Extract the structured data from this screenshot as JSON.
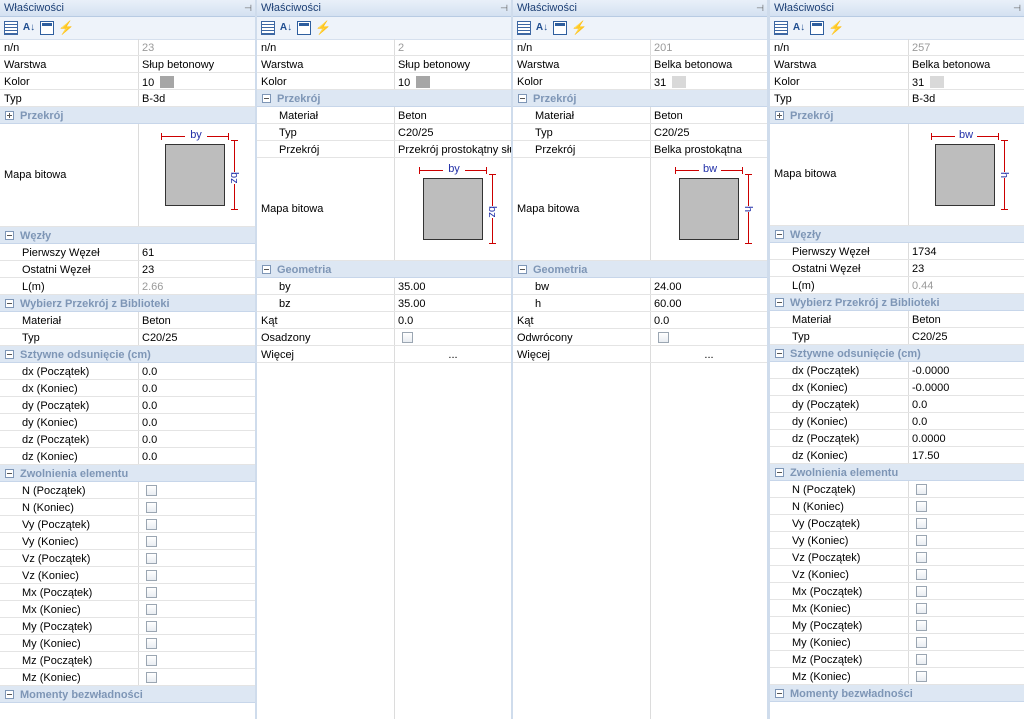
{
  "title": "Właściwości",
  "pin_glyph": "⊣",
  "panels": [
    {
      "rows": [
        {
          "t": "p",
          "n": "n/n",
          "v": "23",
          "ro": true
        },
        {
          "t": "p",
          "n": "Warstwa",
          "v": "Słup betonowy"
        },
        {
          "t": "p",
          "n": "Kolor",
          "v": "10",
          "sw": "#a6a6a6"
        },
        {
          "t": "p",
          "n": "Typ",
          "v": "B-3d"
        },
        {
          "t": "h",
          "n": "Przekrój",
          "c": true
        },
        {
          "t": "b",
          "n": "Mapa bitowa",
          "h1": "by",
          "h2": "bz"
        },
        {
          "t": "h",
          "n": "Węzły"
        },
        {
          "t": "p",
          "n": "Pierwszy Węzeł",
          "v": "61",
          "i": 1
        },
        {
          "t": "p",
          "n": "Ostatni Węzeł",
          "v": "23",
          "i": 1
        },
        {
          "t": "p",
          "n": "L(m)",
          "v": "2.66",
          "i": 1,
          "ro": true
        },
        {
          "t": "h",
          "n": "Wybierz Przekrój z Biblioteki"
        },
        {
          "t": "p",
          "n": "Materiał",
          "v": "Beton",
          "i": 1
        },
        {
          "t": "p",
          "n": "Typ",
          "v": "C20/25",
          "i": 1
        },
        {
          "t": "h",
          "n": "Sztywne odsunięcie (cm)"
        },
        {
          "t": "p",
          "n": "dx (Początek)",
          "v": "0.0",
          "i": 1
        },
        {
          "t": "p",
          "n": "dx (Koniec)",
          "v": "0.0",
          "i": 1
        },
        {
          "t": "p",
          "n": "dy (Początek)",
          "v": "0.0",
          "i": 1
        },
        {
          "t": "p",
          "n": "dy (Koniec)",
          "v": "0.0",
          "i": 1
        },
        {
          "t": "p",
          "n": "dz (Początek)",
          "v": "0.0",
          "i": 1
        },
        {
          "t": "p",
          "n": "dz (Koniec)",
          "v": "0.0",
          "i": 1
        },
        {
          "t": "h",
          "n": "Zwolnienia elementu"
        },
        {
          "t": "c",
          "n": "N (Początek)",
          "i": 1
        },
        {
          "t": "c",
          "n": "N (Koniec)",
          "i": 1
        },
        {
          "t": "c",
          "n": "Vy (Początek)",
          "i": 1
        },
        {
          "t": "c",
          "n": "Vy (Koniec)",
          "i": 1
        },
        {
          "t": "c",
          "n": "Vz (Początek)",
          "i": 1
        },
        {
          "t": "c",
          "n": "Vz (Koniec)",
          "i": 1
        },
        {
          "t": "c",
          "n": "Mx (Początek)",
          "i": 1
        },
        {
          "t": "c",
          "n": "Mx (Koniec)",
          "i": 1
        },
        {
          "t": "c",
          "n": "My (Początek)",
          "i": 1
        },
        {
          "t": "c",
          "n": "My (Koniec)",
          "i": 1
        },
        {
          "t": "c",
          "n": "Mz (Początek)",
          "i": 1
        },
        {
          "t": "c",
          "n": "Mz (Koniec)",
          "i": 1
        },
        {
          "t": "h",
          "n": "Momenty bezwładności"
        }
      ]
    },
    {
      "rows": [
        {
          "t": "p",
          "n": "n/n",
          "v": "2",
          "ro": true
        },
        {
          "t": "p",
          "n": "Warstwa",
          "v": "Słup betonowy"
        },
        {
          "t": "p",
          "n": "Kolor",
          "v": "10",
          "sw": "#a6a6a6"
        },
        {
          "t": "h",
          "n": "Przekrój"
        },
        {
          "t": "p",
          "n": "Materiał",
          "v": "Beton",
          "i": 1
        },
        {
          "t": "p",
          "n": "Typ",
          "v": "C20/25",
          "i": 1
        },
        {
          "t": "p",
          "n": "Przekrój",
          "v": "Przekrój prostokątny słu",
          "i": 1
        },
        {
          "t": "b",
          "n": "Mapa bitowa",
          "h1": "by",
          "h2": "bz"
        },
        {
          "t": "h",
          "n": "Geometria"
        },
        {
          "t": "p",
          "n": "by",
          "v": "35.00",
          "i": 1
        },
        {
          "t": "p",
          "n": "bz",
          "v": "35.00",
          "i": 1
        },
        {
          "t": "p",
          "n": "Kąt",
          "v": "0.0"
        },
        {
          "t": "c",
          "n": "Osadzony"
        },
        {
          "t": "e",
          "n": "Więcej",
          "v": "..."
        },
        {
          "t": "x"
        }
      ]
    },
    {
      "rows": [
        {
          "t": "p",
          "n": "n/n",
          "v": "201",
          "ro": true
        },
        {
          "t": "p",
          "n": "Warstwa",
          "v": "Belka betonowa"
        },
        {
          "t": "p",
          "n": "Kolor",
          "v": "31",
          "sw": "#d9d9d9"
        },
        {
          "t": "h",
          "n": "Przekrój"
        },
        {
          "t": "p",
          "n": "Materiał",
          "v": "Beton",
          "i": 1
        },
        {
          "t": "p",
          "n": "Typ",
          "v": "C20/25",
          "i": 1
        },
        {
          "t": "p",
          "n": "Przekrój",
          "v": "Belka prostokątna",
          "i": 1
        },
        {
          "t": "b",
          "n": "Mapa bitowa",
          "h1": "bw",
          "h2": "h"
        },
        {
          "t": "h",
          "n": "Geometria"
        },
        {
          "t": "p",
          "n": "bw",
          "v": "24.00",
          "i": 1
        },
        {
          "t": "p",
          "n": "h",
          "v": "60.00",
          "i": 1
        },
        {
          "t": "p",
          "n": "Kąt",
          "v": "0.0"
        },
        {
          "t": "c",
          "n": "Odwrócony"
        },
        {
          "t": "e",
          "n": "Więcej",
          "v": "..."
        },
        {
          "t": "x"
        }
      ]
    },
    {
      "rows": [
        {
          "t": "p",
          "n": "n/n",
          "v": "257",
          "ro": true
        },
        {
          "t": "p",
          "n": "Warstwa",
          "v": "Belka betonowa"
        },
        {
          "t": "p",
          "n": "Kolor",
          "v": "31",
          "sw": "#d9d9d9"
        },
        {
          "t": "p",
          "n": "Typ",
          "v": "B-3d"
        },
        {
          "t": "h",
          "n": "Przekrój",
          "c": true
        },
        {
          "t": "b",
          "n": "Mapa bitowa",
          "h1": "bw",
          "h2": "h"
        },
        {
          "t": "h",
          "n": "Węzły"
        },
        {
          "t": "p",
          "n": "Pierwszy Węzeł",
          "v": "1734",
          "i": 1
        },
        {
          "t": "p",
          "n": "Ostatni Węzeł",
          "v": "23",
          "i": 1
        },
        {
          "t": "p",
          "n": "L(m)",
          "v": "0.44",
          "i": 1,
          "ro": true
        },
        {
          "t": "h",
          "n": "Wybierz Przekrój z Biblioteki"
        },
        {
          "t": "p",
          "n": "Materiał",
          "v": "Beton",
          "i": 1
        },
        {
          "t": "p",
          "n": "Typ",
          "v": "C20/25",
          "i": 1
        },
        {
          "t": "h",
          "n": "Sztywne odsunięcie (cm)"
        },
        {
          "t": "p",
          "n": "dx (Początek)",
          "v": "-0.0000",
          "i": 1
        },
        {
          "t": "p",
          "n": "dx (Koniec)",
          "v": "-0.0000",
          "i": 1
        },
        {
          "t": "p",
          "n": "dy (Początek)",
          "v": "0.0",
          "i": 1
        },
        {
          "t": "p",
          "n": "dy (Koniec)",
          "v": "0.0",
          "i": 1
        },
        {
          "t": "p",
          "n": "dz (Początek)",
          "v": "0.0000",
          "i": 1
        },
        {
          "t": "p",
          "n": "dz (Koniec)",
          "v": "17.50",
          "i": 1
        },
        {
          "t": "h",
          "n": "Zwolnienia elementu"
        },
        {
          "t": "c",
          "n": "N (Początek)",
          "i": 1
        },
        {
          "t": "c",
          "n": "N (Koniec)",
          "i": 1
        },
        {
          "t": "c",
          "n": "Vy (Początek)",
          "i": 1
        },
        {
          "t": "c",
          "n": "Vy (Koniec)",
          "i": 1
        },
        {
          "t": "c",
          "n": "Vz (Początek)",
          "i": 1
        },
        {
          "t": "c",
          "n": "Vz (Koniec)",
          "i": 1
        },
        {
          "t": "c",
          "n": "Mx (Początek)",
          "i": 1
        },
        {
          "t": "c",
          "n": "Mx (Koniec)",
          "i": 1
        },
        {
          "t": "c",
          "n": "My (Początek)",
          "i": 1
        },
        {
          "t": "c",
          "n": "My (Koniec)",
          "i": 1
        },
        {
          "t": "c",
          "n": "Mz (Początek)",
          "i": 1
        },
        {
          "t": "c",
          "n": "Mz (Koniec)",
          "i": 1
        },
        {
          "t": "h",
          "n": "Momenty bezwładności"
        }
      ]
    }
  ]
}
